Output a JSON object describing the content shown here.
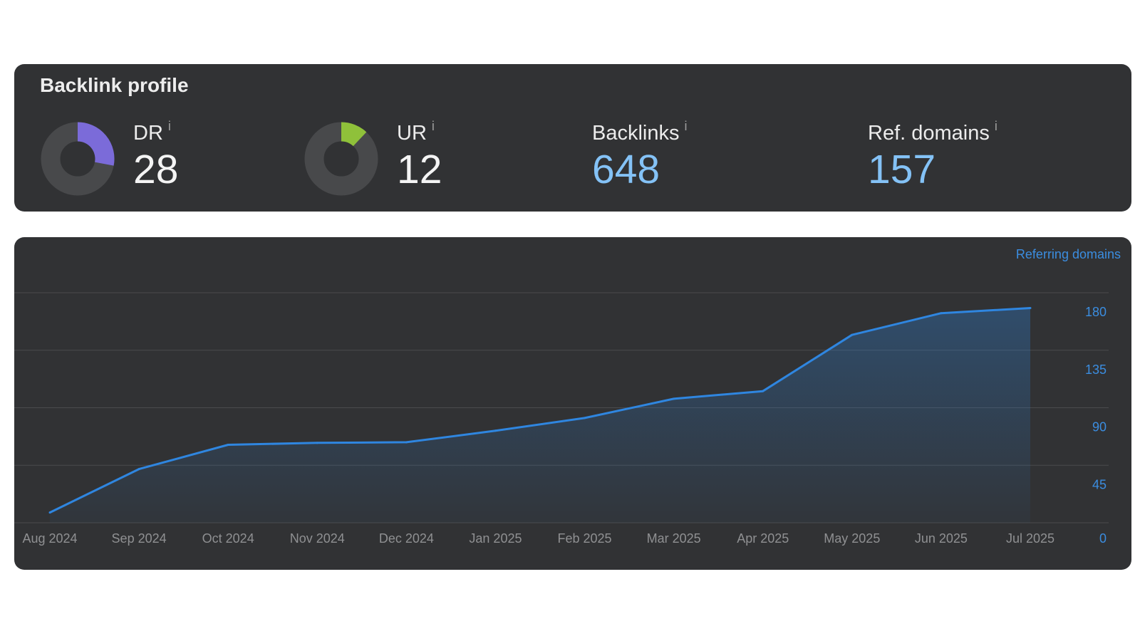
{
  "profile": {
    "title": "Backlink profile",
    "info_icon": "i",
    "metrics": [
      {
        "label": "DR",
        "value": "28",
        "gauge_fraction": 0.28,
        "gauge_color": "#7b6bd9"
      },
      {
        "label": "UR",
        "value": "12",
        "gauge_fraction": 0.12,
        "gauge_color": "#8fc13a"
      },
      {
        "label": "Backlinks",
        "value": "648"
      },
      {
        "label": "Ref. domains",
        "value": "157"
      }
    ],
    "gauge_track_color": "#48494b"
  },
  "chart_data": {
    "type": "area",
    "ylabel": "Referring domains",
    "x": [
      "Aug 2024",
      "Sep 2024",
      "Oct 2024",
      "Nov 2024",
      "Dec 2024",
      "Jan 2025",
      "Feb 2025",
      "Mar 2025",
      "Apr 2025",
      "May 2025",
      "Jun 2025",
      "Jul 2025"
    ],
    "series": [
      {
        "values": [
          8,
          42,
          61,
          62.5,
          63,
          72,
          82,
          97,
          103,
          147,
          164,
          168
        ],
        "color": "#2f86e0"
      }
    ],
    "ylim": [
      0,
      180
    ],
    "yticks": [
      0,
      45,
      90,
      135,
      180
    ],
    "grid": true,
    "axis_position": "right"
  }
}
